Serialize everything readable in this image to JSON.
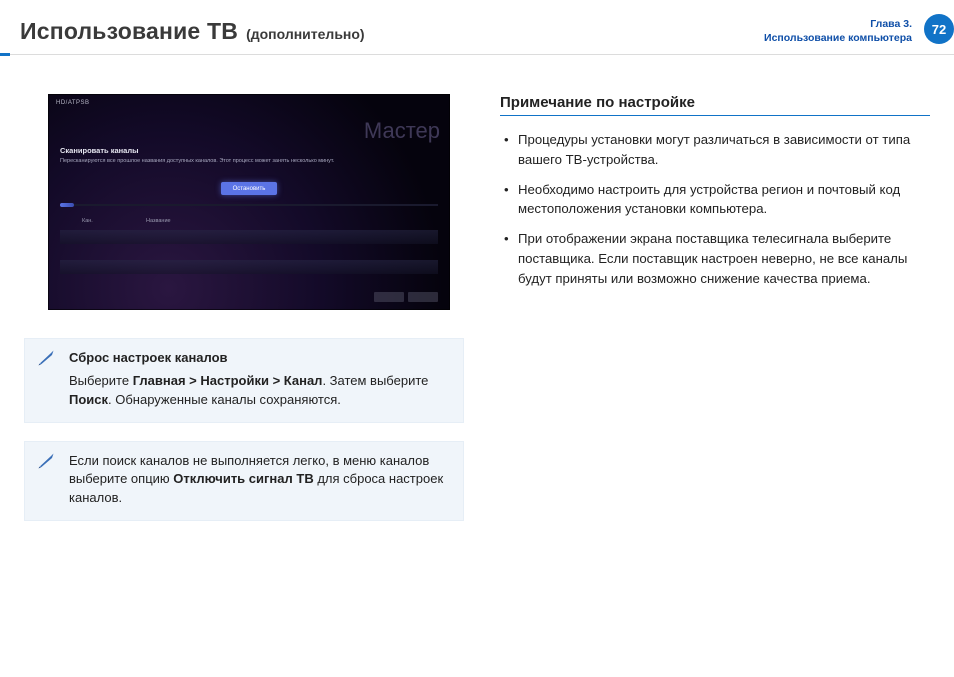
{
  "header": {
    "title_main": "Использование ТВ",
    "title_sub": "(дополнительно)",
    "chapter_line1": "Глава 3.",
    "chapter_line2": "Использование компьютера",
    "page_number": "72"
  },
  "screenshot": {
    "topbar": "HD/ATPSB",
    "ghost_word": "Мастер",
    "scan_title": "Сканировать каналы",
    "scan_desc": "Пересканируются все прошлое названия доступных каналов. Этот процесс может занять несколько минут.",
    "stop_button": "Остановить",
    "col1": "Кан.",
    "col2": "Название"
  },
  "notes": [
    {
      "title": "Сброс настроек каналов",
      "body_html": "Выберите <b>Главная > Настройки > Канал</b>. Затем выберите <b>Поиск</b>. Обнаруженные каналы сохраняются."
    },
    {
      "title": "",
      "body_html": "Если поиск каналов не выполняется легко, в меню каналов выберите опцию <b>Отключить сигнал ТВ</b> для сброса настроек каналов."
    }
  ],
  "right": {
    "section_title": "Примечание по настройке",
    "bullets": [
      "Процедуры установки могут различаться в зависимости от типа вашего ТВ-устройства.",
      "Необходимо настроить для устройства регион и почтовый код местоположения установки компьютера.",
      "При отображении экрана поставщика телесигнала выберите поставщика. Если поставщик настроен неверно, не все каналы будут приняты или возможно снижение качества приема."
    ]
  }
}
